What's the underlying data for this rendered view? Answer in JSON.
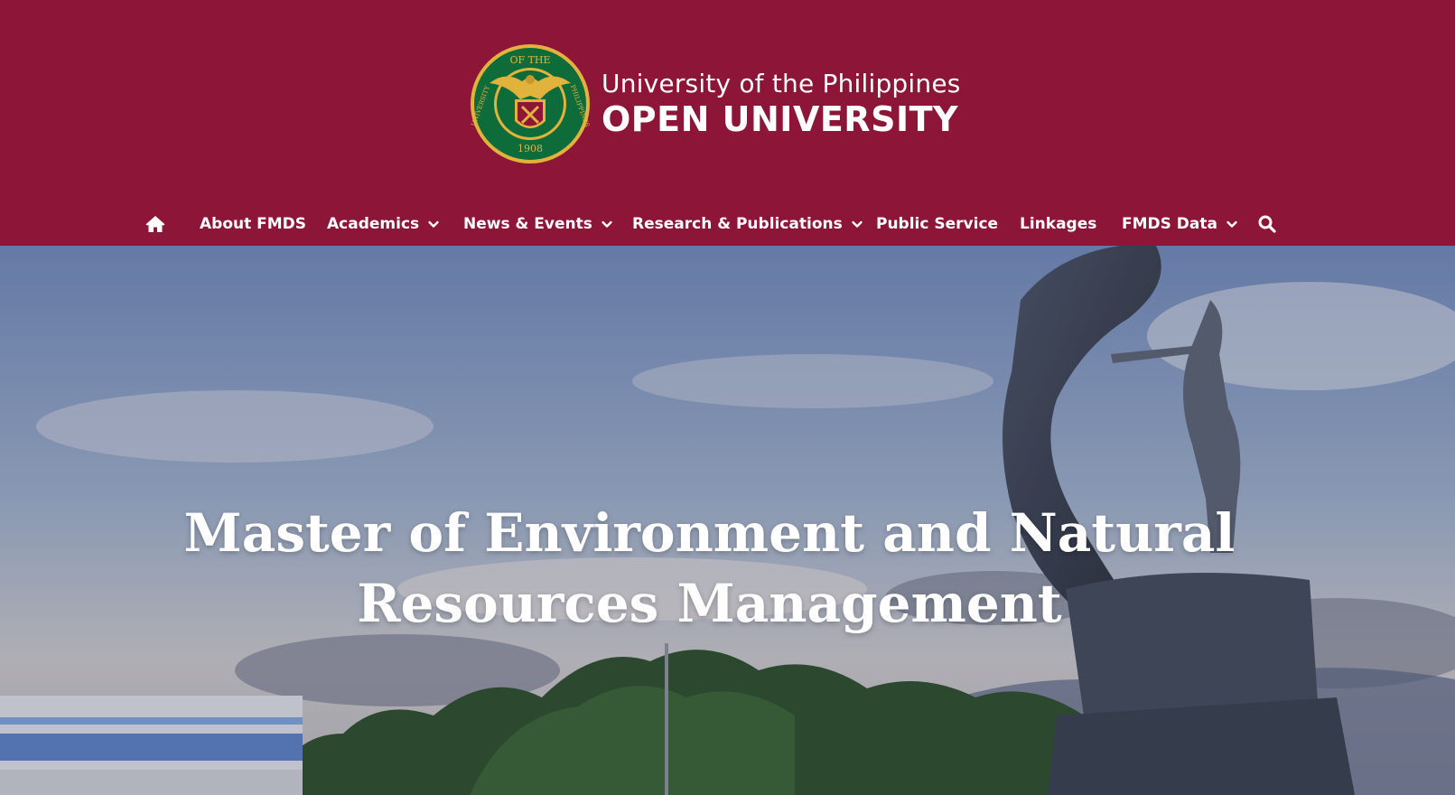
{
  "branding": {
    "seal_name": "university-seal",
    "line1": "University of the Philippines",
    "line2": "OPEN UNIVERSITY",
    "seal_text_top": "OF THE",
    "seal_text_left": "UNIVERSITY",
    "seal_text_right": "PHILIPPINES",
    "seal_year": "1908",
    "colors": {
      "maroon": "#8c1538",
      "seal_green": "#0e6b3a",
      "seal_gold": "#e2b33c"
    }
  },
  "nav": {
    "home_icon": "home-icon",
    "items": [
      {
        "label": "About FMDS",
        "has_dropdown": false
      },
      {
        "label": "Academics",
        "has_dropdown": true
      },
      {
        "label": "News & Events",
        "has_dropdown": true
      },
      {
        "label": "Research & Publications",
        "has_dropdown": true
      },
      {
        "label": "Public Service",
        "has_dropdown": false
      },
      {
        "label": "Linkages",
        "has_dropdown": false
      },
      {
        "label": "FMDS Data",
        "has_dropdown": true
      }
    ],
    "search_icon": "search-icon"
  },
  "hero": {
    "title": "Master of Environment and Natural Resources Management"
  }
}
